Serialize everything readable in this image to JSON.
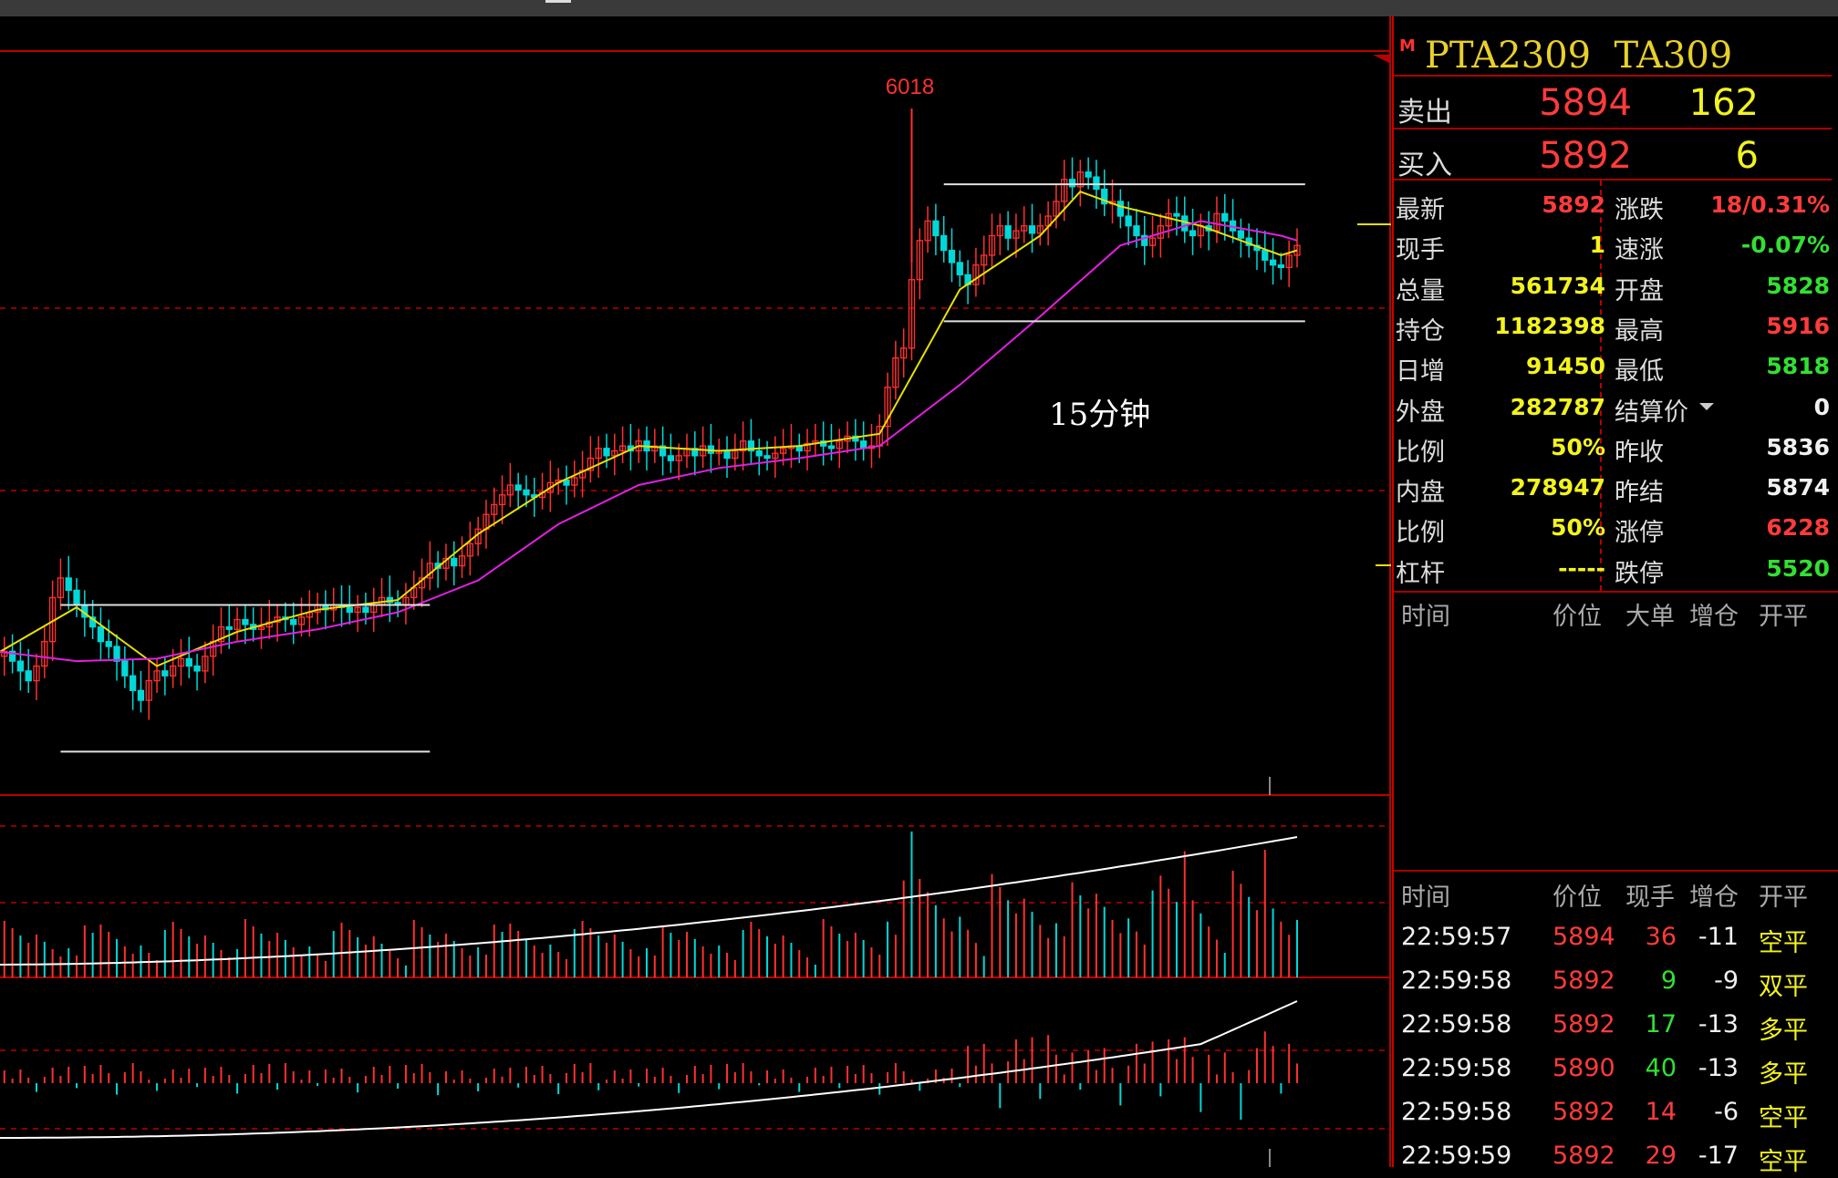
{
  "header": {
    "contract": "PTA2309",
    "code": "TA309",
    "market_flag": "M"
  },
  "quote": {
    "sell": {
      "label": "卖出",
      "price": "5894",
      "volume": "162"
    },
    "buy": {
      "label": "买入",
      "price": "5892",
      "volume": "6"
    }
  },
  "stats": [
    {
      "label": "最新",
      "value": "5892",
      "value_color": "red",
      "label2": "涨跌",
      "value2": "18/0.31%",
      "value2_color": "red"
    },
    {
      "label": "现手",
      "value": "1",
      "value_color": "yellow",
      "label2": "速涨",
      "value2": "-0.07%",
      "value2_color": "green"
    },
    {
      "label": "总量",
      "value": "561734",
      "value_color": "yellow",
      "label2": "开盘",
      "value2": "5828",
      "value2_color": "green"
    },
    {
      "label": "持仓",
      "value": "1182398",
      "value_color": "yellow",
      "label2": "最高",
      "value2": "5916",
      "value2_color": "red"
    },
    {
      "label": "日增",
      "value": "91450",
      "value_color": "yellow",
      "label2": "最低",
      "value2": "5818",
      "value2_color": "green"
    },
    {
      "label": "外盘",
      "value": "282787",
      "value_color": "yellow",
      "label2": "结算价",
      "value2": "0",
      "value2_color": "white"
    },
    {
      "label": "比例",
      "value": "50%",
      "value_color": "yellow",
      "label2": "昨收",
      "value2": "5836",
      "value2_color": "white"
    },
    {
      "label": "内盘",
      "value": "278947",
      "value_color": "yellow",
      "label2": "昨结",
      "value2": "5874",
      "value2_color": "white"
    },
    {
      "label": "比例",
      "value": "50%",
      "value_color": "yellow",
      "label2": "涨停",
      "value2": "6228",
      "value2_color": "red"
    },
    {
      "label": "杠杆",
      "value": "-----",
      "value_color": "yellow",
      "label2": "跌停",
      "value2": "5520",
      "value2_color": "green"
    }
  ],
  "big_orders": {
    "headers": [
      "时间",
      "价位",
      "大单",
      "增仓",
      "开平"
    ]
  },
  "ticks": {
    "headers": [
      "时间",
      "价位",
      "现手",
      "增仓",
      "开平"
    ],
    "rows": [
      {
        "time": "22:59:57",
        "price": "5894",
        "vol": "36",
        "vol_color": "red",
        "oi": "-11",
        "type": "空平"
      },
      {
        "time": "22:59:58",
        "price": "5892",
        "vol": "9",
        "vol_color": "green",
        "oi": "-9",
        "type": "双平"
      },
      {
        "time": "22:59:58",
        "price": "5892",
        "vol": "17",
        "vol_color": "green",
        "oi": "-13",
        "type": "多平"
      },
      {
        "time": "22:59:58",
        "price": "5890",
        "vol": "40",
        "vol_color": "green",
        "oi": "-13",
        "type": "多平"
      },
      {
        "time": "22:59:58",
        "price": "5892",
        "vol": "14",
        "vol_color": "red",
        "oi": "-6",
        "type": "空平"
      },
      {
        "time": "22:59:59",
        "price": "5892",
        "vol": "29",
        "vol_color": "red",
        "oi": "-17",
        "type": "空平"
      }
    ]
  },
  "colors": {
    "up": "#ff3030",
    "down": "#00d8d8",
    "ma_short": "#e8e000",
    "ma_long": "#e020e0",
    "grid": "#bb0000",
    "box": "#e0e0e0"
  },
  "chart_data": {
    "type": "candlestick",
    "title": "",
    "annotation": "15分钟",
    "high_label": "6018",
    "ylim": [
      5735,
      6040
    ],
    "series": [
      {
        "name": "price",
        "points": [
          [
            0,
            5794
          ],
          [
            1,
            5796
          ],
          [
            2,
            5792
          ],
          [
            3,
            5788
          ],
          [
            4,
            5784
          ],
          [
            5,
            5790
          ],
          [
            6,
            5800
          ],
          [
            7,
            5818
          ],
          [
            8,
            5826
          ],
          [
            9,
            5821
          ],
          [
            10,
            5815
          ],
          [
            11,
            5810
          ],
          [
            12,
            5806
          ],
          [
            13,
            5800
          ],
          [
            14,
            5798
          ],
          [
            15,
            5792
          ],
          [
            16,
            5786
          ],
          [
            17,
            5780
          ],
          [
            18,
            5776
          ],
          [
            19,
            5784
          ],
          [
            20,
            5788
          ],
          [
            21,
            5786
          ],
          [
            22,
            5790
          ],
          [
            23,
            5793
          ],
          [
            24,
            5790
          ],
          [
            25,
            5788
          ],
          [
            26,
            5794
          ],
          [
            27,
            5800
          ],
          [
            28,
            5806
          ],
          [
            29,
            5805
          ],
          [
            30,
            5809
          ],
          [
            31,
            5807
          ],
          [
            32,
            5805
          ],
          [
            33,
            5806
          ],
          [
            34,
            5808
          ],
          [
            35,
            5810
          ],
          [
            36,
            5809
          ],
          [
            37,
            5807
          ],
          [
            38,
            5810
          ],
          [
            39,
            5812
          ],
          [
            40,
            5815
          ],
          [
            41,
            5813
          ],
          [
            42,
            5815
          ],
          [
            43,
            5814
          ],
          [
            44,
            5812
          ],
          [
            45,
            5814
          ],
          [
            46,
            5812
          ],
          [
            47,
            5815
          ],
          [
            48,
            5818
          ],
          [
            49,
            5816
          ],
          [
            50,
            5815
          ],
          [
            51,
            5818
          ],
          [
            52,
            5822
          ],
          [
            53,
            5826
          ],
          [
            54,
            5832
          ],
          [
            55,
            5830
          ],
          [
            56,
            5834
          ],
          [
            57,
            5831
          ],
          [
            58,
            5835
          ],
          [
            59,
            5840
          ],
          [
            60,
            5846
          ],
          [
            61,
            5852
          ],
          [
            62,
            5856
          ],
          [
            63,
            5860
          ],
          [
            64,
            5864
          ],
          [
            65,
            5862
          ],
          [
            66,
            5860
          ],
          [
            67,
            5859
          ],
          [
            68,
            5861
          ],
          [
            69,
            5865
          ],
          [
            70,
            5866
          ],
          [
            71,
            5864
          ],
          [
            72,
            5867
          ],
          [
            73,
            5870
          ],
          [
            74,
            5875
          ],
          [
            75,
            5879
          ],
          [
            76,
            5876
          ],
          [
            77,
            5878
          ],
          [
            78,
            5880
          ],
          [
            79,
            5878
          ],
          [
            80,
            5882
          ],
          [
            81,
            5878
          ],
          [
            82,
            5880
          ],
          [
            83,
            5876
          ],
          [
            84,
            5874
          ],
          [
            85,
            5876
          ],
          [
            86,
            5879
          ],
          [
            87,
            5876
          ],
          [
            88,
            5880
          ],
          [
            89,
            5877
          ],
          [
            90,
            5878
          ],
          [
            91,
            5875
          ],
          [
            92,
            5878
          ],
          [
            93,
            5882
          ],
          [
            94,
            5878
          ],
          [
            95,
            5876
          ],
          [
            96,
            5875
          ],
          [
            97,
            5877
          ],
          [
            98,
            5879
          ],
          [
            99,
            5880
          ],
          [
            100,
            5878
          ],
          [
            101,
            5881
          ],
          [
            102,
            5882
          ],
          [
            103,
            5880
          ],
          [
            104,
            5879
          ],
          [
            105,
            5882
          ],
          [
            106,
            5884
          ],
          [
            107,
            5882
          ],
          [
            108,
            5879
          ],
          [
            109,
            5880
          ],
          [
            110,
            5888
          ],
          [
            111,
            5904
          ],
          [
            112,
            5916
          ],
          [
            113,
            5920
          ],
          [
            114,
            5948
          ],
          [
            115,
            5964
          ],
          [
            116,
            5972
          ],
          [
            117,
            5966
          ],
          [
            118,
            5960
          ],
          [
            119,
            5955
          ],
          [
            120,
            5950
          ],
          [
            121,
            5946
          ],
          [
            122,
            5954
          ],
          [
            123,
            5958
          ],
          [
            124,
            5966
          ],
          [
            125,
            5970
          ],
          [
            126,
            5965
          ],
          [
            127,
            5968
          ],
          [
            128,
            5970
          ],
          [
            129,
            5967
          ],
          [
            130,
            5970
          ],
          [
            131,
            5974
          ],
          [
            132,
            5980
          ],
          [
            133,
            5989
          ],
          [
            134,
            5986
          ],
          [
            135,
            5992
          ],
          [
            136,
            5990
          ],
          [
            137,
            5985
          ],
          [
            138,
            5979
          ],
          [
            139,
            5980
          ],
          [
            140,
            5974
          ],
          [
            141,
            5970
          ],
          [
            142,
            5966
          ],
          [
            143,
            5962
          ],
          [
            144,
            5965
          ],
          [
            145,
            5970
          ],
          [
            146,
            5975
          ],
          [
            147,
            5974
          ],
          [
            148,
            5968
          ],
          [
            149,
            5966
          ],
          [
            150,
            5970
          ],
          [
            151,
            5968
          ],
          [
            152,
            5975
          ],
          [
            153,
            5972
          ],
          [
            154,
            5968
          ],
          [
            155,
            5965
          ],
          [
            156,
            5962
          ],
          [
            157,
            5960
          ],
          [
            158,
            5956
          ],
          [
            159,
            5954
          ],
          [
            160,
            5953
          ],
          [
            161,
            5958
          ],
          [
            162,
            5962
          ]
        ]
      },
      {
        "name": "MA-short",
        "points": [
          [
            0,
            5795
          ],
          [
            10,
            5814
          ],
          [
            20,
            5790
          ],
          [
            30,
            5804
          ],
          [
            40,
            5813
          ],
          [
            50,
            5817
          ],
          [
            60,
            5844
          ],
          [
            70,
            5865
          ],
          [
            80,
            5880
          ],
          [
            90,
            5878
          ],
          [
            100,
            5880
          ],
          [
            110,
            5885
          ],
          [
            120,
            5944
          ],
          [
            130,
            5966
          ],
          [
            135,
            5984
          ],
          [
            140,
            5978
          ],
          [
            150,
            5970
          ],
          [
            160,
            5958
          ],
          [
            162,
            5960
          ]
        ]
      },
      {
        "name": "MA-long",
        "points": [
          [
            0,
            5796
          ],
          [
            10,
            5792
          ],
          [
            20,
            5793
          ],
          [
            30,
            5800
          ],
          [
            40,
            5805
          ],
          [
            50,
            5812
          ],
          [
            60,
            5825
          ],
          [
            70,
            5848
          ],
          [
            80,
            5864
          ],
          [
            90,
            5871
          ],
          [
            100,
            5875
          ],
          [
            110,
            5880
          ],
          [
            120,
            5905
          ],
          [
            130,
            5933
          ],
          [
            140,
            5962
          ],
          [
            150,
            5972
          ],
          [
            160,
            5966
          ],
          [
            162,
            5964
          ]
        ]
      }
    ],
    "boxes": [
      {
        "from": 8,
        "to": 54,
        "top": 5815,
        "bottom": 5755
      },
      {
        "from": 118,
        "to": 163,
        "top": 5987,
        "bottom": 5931
      }
    ]
  }
}
